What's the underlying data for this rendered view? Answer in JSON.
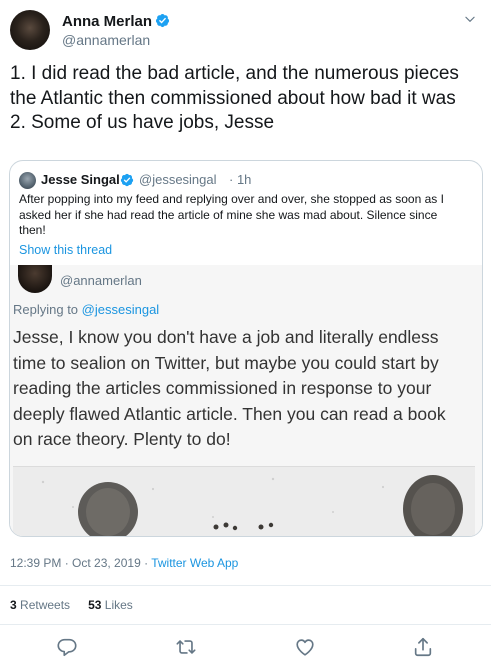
{
  "author": {
    "name": "Anna Merlan",
    "handle": "@annamerlan"
  },
  "tweet": {
    "lines": [
      "1. I did read the bad article, and the numerous pieces",
      "the Atlantic then commissioned about how bad it was",
      "2. Some of us have jobs, Jesse"
    ]
  },
  "quoted": {
    "name": "Jesse Singal",
    "handle": "@jessesingal",
    "time": "· 1h",
    "lines": [
      "After popping into my feed and replying over and over, she stopped as soon as I",
      "asked her if she had read the article of mine she was mad about. Silence since",
      "then!"
    ],
    "show_thread": "Show this thread",
    "screenshot": {
      "handle": "@annamerlan",
      "replying_prefix": "Replying to",
      "replying_handle": "@jessesingal",
      "lines": [
        "Jesse, I know you don't have a job and literally endless",
        "time to sealion on Twitter, but maybe you could start by",
        "reading the articles commissioned in response to your",
        "deeply flawed Atlantic article. Then you can read a book",
        "on race theory. Plenty to do!"
      ]
    }
  },
  "meta": {
    "timestamp": "12:39 PM · Oct 23, 2019 ·",
    "source": "Twitter Web App"
  },
  "stats": {
    "retweets_count": "3",
    "retweets_label": "Retweets",
    "likes_count": "53",
    "likes_label": "Likes"
  },
  "icons": {
    "verified": "verified-badge-icon",
    "caret": "chevron-down-icon",
    "reply": "reply-icon",
    "retweet": "retweet-icon",
    "like": "heart-icon",
    "share": "share-icon"
  },
  "colors": {
    "accent": "#1b95e0",
    "verified": "#1da1f2",
    "muted": "#657786",
    "border": "#ccd6dd"
  }
}
